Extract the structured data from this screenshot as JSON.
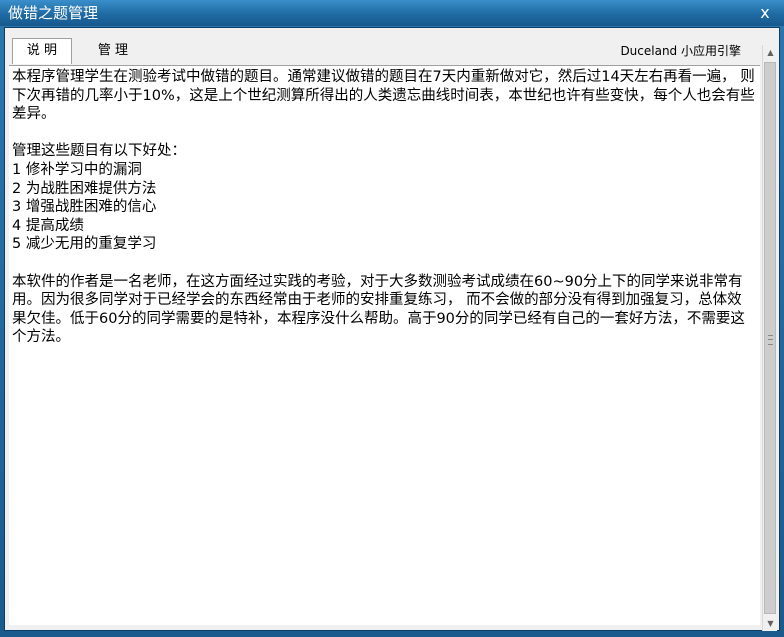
{
  "window": {
    "title": "做错之题管理",
    "close_label": "x"
  },
  "tabs": [
    {
      "label": "说 明",
      "active": true
    },
    {
      "label": "管 理",
      "active": false
    }
  ],
  "brand": "Duceland 小应用引擎",
  "content": {
    "p1": "本程序管理学生在测验考试中做错的题目。通常建议做错的题目在7天内重新做对它，然后过14天左右再看一遍， 则下次再错的几率小于10%，这是上个世纪测算所得出的人类遗忘曲线时间表，本世纪也许有些变快，每个人也会有些差异。",
    "benefits_title": "管理这些题目有以下好处：",
    "benefits": [
      "1 修补学习中的漏洞",
      "2 为战胜困难提供方法",
      "3 增强战胜困难的信心",
      "4 提高成绩",
      "5 减少无用的重复学习"
    ],
    "p2": "本软件的作者是一名老师，在这方面经过实践的考验，对于大多数测验考试成绩在60~90分上下的同学来说非常有用。因为很多同学对于已经学会的东西经常由于老师的安排重复练习，  而不会做的部分没有得到加强复习，总体效果欠佳。低于60分的同学需要的是特补，本程序没什么帮助。高于90分的同学已经有自己的一套好方法，不需要这个方法。"
  }
}
